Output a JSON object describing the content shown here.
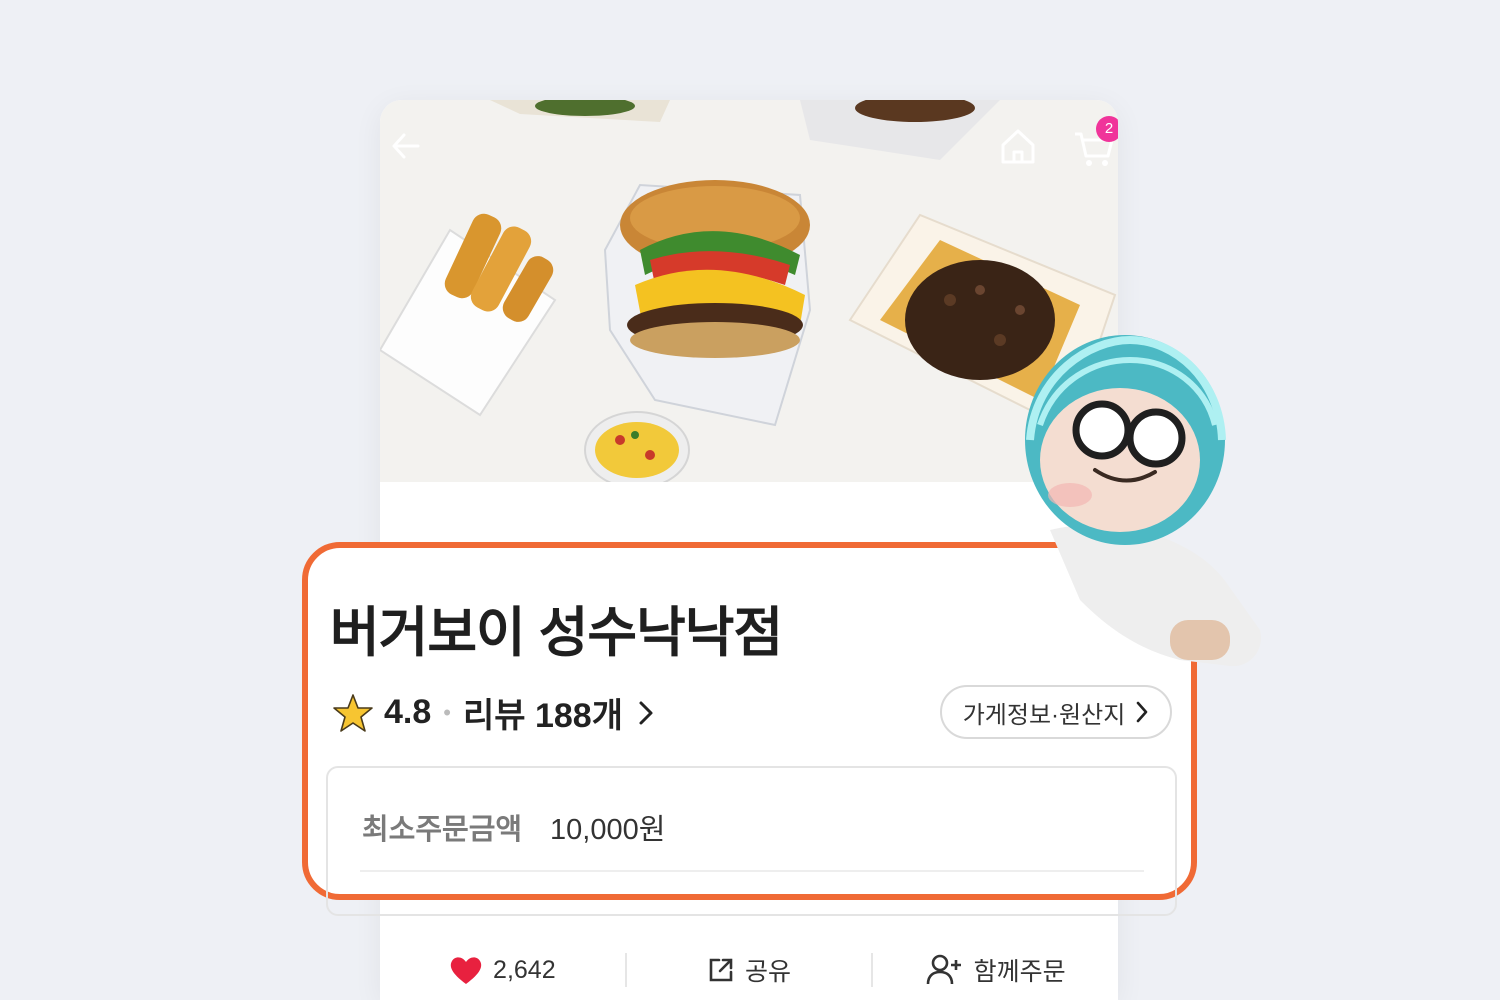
{
  "header": {
    "cart_count": "2"
  },
  "store": {
    "name": "버거보이 성수낙낙점",
    "rating": "4.8",
    "reviews": "리뷰 188개",
    "info_button": "가게정보·원산지",
    "min_order_label": "최소주문금액",
    "min_order_value": "10,000원"
  },
  "actions": {
    "likes": "2,642",
    "share": "공유",
    "group_order": "함께주문"
  },
  "colors": {
    "accent": "#f06a35",
    "badge": "#f0349a",
    "heart": "#e8213f",
    "star": "#f7c531"
  },
  "icons": [
    "back-arrow-icon",
    "home-icon",
    "cart-icon",
    "star-icon",
    "chevron-right-icon",
    "heart-icon",
    "share-icon",
    "add-person-icon"
  ]
}
